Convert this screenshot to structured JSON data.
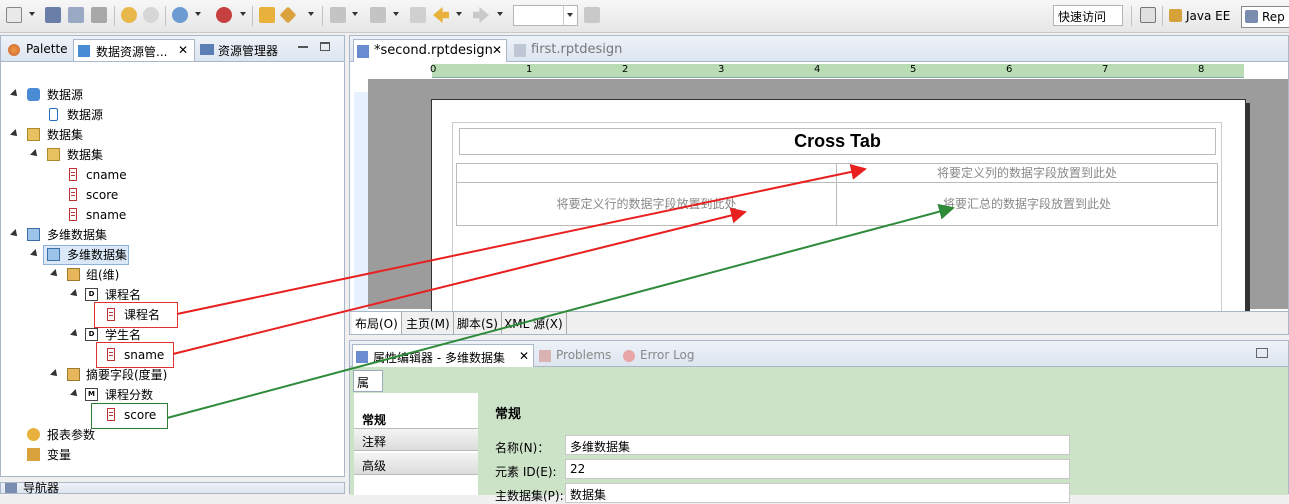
{
  "toolbar": {
    "quick_access": "快速访问",
    "perspectives": [
      "Java EE",
      "Rep"
    ]
  },
  "left_panel": {
    "tabs": [
      "Palette",
      "数据资源管...",
      "资源管理器"
    ],
    "tree": [
      {
        "label": "数据源"
      },
      {
        "label": "数据源"
      },
      {
        "label": "数据集"
      },
      {
        "label": "数据集"
      },
      {
        "label": "cname"
      },
      {
        "label": "score"
      },
      {
        "label": "sname"
      },
      {
        "label": "多维数据集"
      },
      {
        "label": "多维数据集"
      },
      {
        "label": "组(维)"
      },
      {
        "label": "课程名"
      },
      {
        "label": "课程名"
      },
      {
        "label": "学生名"
      },
      {
        "label": "sname"
      },
      {
        "label": "摘要字段(度量)"
      },
      {
        "label": "课程分数"
      },
      {
        "label": "score"
      },
      {
        "label": "报表参数"
      },
      {
        "label": "变量"
      }
    ],
    "bottom_tab": "导航器"
  },
  "editor": {
    "tabs": [
      "*second.rptdesign",
      "first.rptdesign"
    ],
    "ruler_numbers": [
      "0",
      "1",
      "2",
      "3",
      "4",
      "5",
      "6",
      "7",
      "8"
    ],
    "crosstab": {
      "title": "Cross Tab",
      "column_hint": "将要定义列的数据字段放置到此处",
      "row_hint": "将要定义行的数据字段放置到此处",
      "summary_hint": "将要汇总的数据字段放置到此处"
    },
    "bottom_tabs": [
      "布局(O)",
      "主页(M)",
      "脚本(S)",
      "XML 源(X)"
    ]
  },
  "props": {
    "tabs": [
      "属性编辑器 - 多维数据集",
      "Problems",
      "Error Log"
    ],
    "subtab": "属性",
    "side_items": [
      "常规",
      "注释",
      "高级"
    ],
    "section_title": "常规",
    "fields": [
      {
        "label": "名称(N)：",
        "value": "多维数据集"
      },
      {
        "label": "元素 ID(E):",
        "value": "22"
      },
      {
        "label": "主数据集(P):",
        "value": "数据集"
      }
    ]
  },
  "colors": {
    "arrow_red": "#e82020",
    "arrow_green": "#2e8b3a",
    "ruler": "#b9dcb4",
    "props_bg": "#cde3c8"
  }
}
